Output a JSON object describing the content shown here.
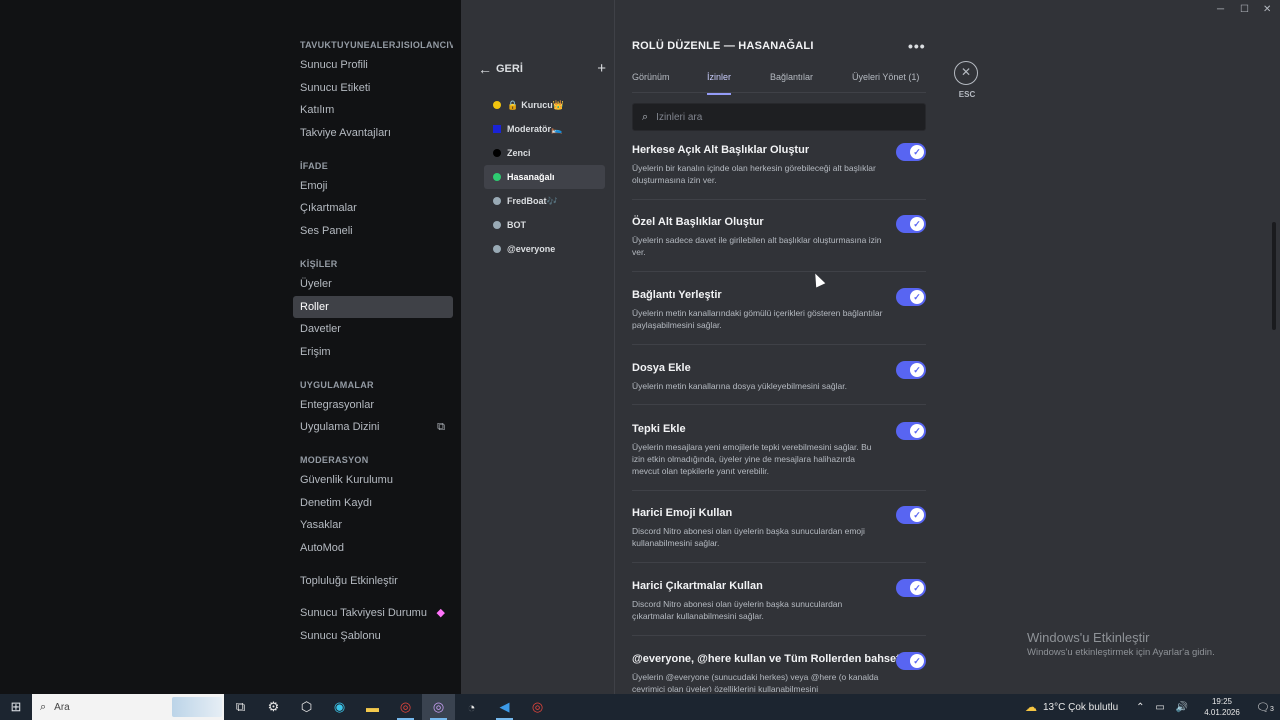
{
  "sidebar": {
    "server_header": "TAVUKTUYUNEALERJISIOLANCIVCI...",
    "server_items": [
      "Sunucu Profili",
      "Sunucu Etiketi",
      "Katılım",
      "Takviye Avantajları"
    ],
    "ifade_header": "İFADE",
    "ifade_items": [
      "Emoji",
      "Çıkartmalar",
      "Ses Paneli"
    ],
    "kisiler_header": "KİŞİLER",
    "kisiler_items": [
      "Üyeler",
      "Roller",
      "Davetler",
      "Erişim"
    ],
    "apps_header": "UYGULAMALAR",
    "apps_items": [
      "Entegrasyonlar",
      "Uygulama Dizini"
    ],
    "mod_header": "MODERASYON",
    "mod_items": [
      "Güvenlik Kurulumu",
      "Denetim Kaydı",
      "Yasaklar",
      "AutoMod"
    ],
    "community_item": "Topluluğu Etkinleştir",
    "boost_status": "Sunucu Takviyesi Durumu",
    "templates": "Sunucu Şablonu"
  },
  "roles": {
    "back_label": "GERİ",
    "add_icon": "plus-icon",
    "list": [
      {
        "name": "Kurucu",
        "suffix": "👑",
        "color": "#f1c40f",
        "locked": true
      },
      {
        "name": "Moderatör",
        "suffix": "🛌",
        "color": "#1a23d6",
        "locked": false
      },
      {
        "name": "Zenci",
        "suffix": "",
        "color": "#000000",
        "locked": false
      },
      {
        "name": "Hasanağalı",
        "suffix": "",
        "color": "#2ecc71",
        "locked": false
      },
      {
        "name": "FredBoat",
        "suffix": "🎶",
        "color": "#99aab5",
        "locked": false
      },
      {
        "name": "BOT",
        "suffix": "",
        "color": "#99aab5",
        "locked": false
      },
      {
        "name": "@everyone",
        "suffix": "",
        "color": "#99aab5",
        "locked": false
      }
    ]
  },
  "edit": {
    "title": "ROLÜ DÜZENLE — HASANAĞALI",
    "tabs": [
      "Görünüm",
      "İzinler",
      "Bağlantılar",
      "Üyeleri Yönet (1)"
    ],
    "search_placeholder": "İzinleri ara",
    "permissions": [
      {
        "title": "Herkese Açık Alt Başlıklar Oluştur",
        "desc": "Üyelerin bir kanalın içinde olan herkesin görebileceği alt başlıklar oluşturmasına izin ver.",
        "enabled": true
      },
      {
        "title": "Özel Alt Başlıklar Oluştur",
        "desc": "Üyelerin sadece davet ile girilebilen alt başlıklar oluşturmasına izin ver.",
        "enabled": true
      },
      {
        "title": "Bağlantı Yerleştir",
        "desc": "Üyelerin metin kanallarındaki gömülü içerikleri gösteren bağlantılar paylaşabilmesini sağlar.",
        "enabled": true
      },
      {
        "title": "Dosya Ekle",
        "desc": "Üyelerin metin kanallarına dosya yükleyebilmesini sağlar.",
        "enabled": true
      },
      {
        "title": "Tepki Ekle",
        "desc": "Üyelerin mesajlara yeni emojilerle tepki verebilmesini sağlar. Bu izin etkin olmadığında, üyeler yine de mesajlara halihazırda mevcut olan tepkilerle yanıt verebilir.",
        "enabled": true
      },
      {
        "title": "Harici Emoji Kullan",
        "desc": "Discord Nitro abonesi olan üyelerin başka sunuculardan emoji kullanabilmesini sağlar.",
        "enabled": true
      },
      {
        "title": "Harici Çıkartmalar Kullan",
        "desc": "Discord Nitro abonesi olan üyelerin başka sunuculardan çıkartmalar kullanabilmesini sağlar.",
        "enabled": true
      },
      {
        "title": "@everyone, @here kullan ve Tüm Rollerden bahset",
        "desc": "Üyelerin @everyone (sunucudaki herkes) veya @here (o kanalda çevrimiçi olan üyeler) özelliklerini kullanabilmesini",
        "enabled": true
      }
    ]
  },
  "esc_label": "ESC",
  "watermark": {
    "line1": "Windows'u Etkinleştir",
    "line2": "Windows'u etkinleştirmek için Ayarlar'a gidin."
  },
  "taskbar": {
    "search_text": "Ara",
    "weather": "13°C  Çok bulutlu",
    "time": "19:25",
    "date": "4.01.2026",
    "notif_count": "3"
  },
  "colors": {
    "accent": "#5865f2",
    "sidebar_bg": "#111214",
    "main_bg": "#313338"
  }
}
